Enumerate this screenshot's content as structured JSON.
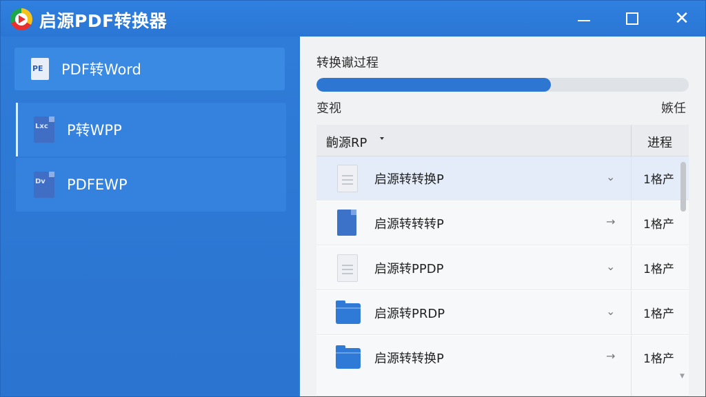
{
  "window": {
    "title": "启源PDF转换器",
    "close_glyph": "✕"
  },
  "sidebar": {
    "items": [
      {
        "label": "PDF转Word",
        "icon": "pe-doc-icon",
        "icon_text": "PE"
      },
      {
        "label": "P转WPP",
        "icon": "lxg-doc-icon",
        "icon_text": "Lxc"
      },
      {
        "label": "PDFEWP",
        "icon": "pdv-doc-icon",
        "icon_text": "Dv"
      }
    ]
  },
  "progress": {
    "title": "转换谳过程",
    "value_percent": 63,
    "left_label": "变视",
    "right_label": "嫉任"
  },
  "table": {
    "columns": {
      "name": "齣源RP",
      "progress": "进程"
    },
    "rows": [
      {
        "name": "启源转转换P",
        "icon": "file-gray-icon",
        "action": "⌄",
        "progress": "1格产",
        "selected": true
      },
      {
        "name": "启源转转转P",
        "icon": "file-blue-icon",
        "action": "→",
        "progress": "1格产",
        "selected": false
      },
      {
        "name": "启源转PPDP",
        "icon": "file-gray-icon",
        "action": "⌄",
        "progress": "1格产",
        "selected": false
      },
      {
        "name": "启源转PRDP",
        "icon": "folder-icon",
        "action": "⌄",
        "progress": "1格产",
        "selected": false
      },
      {
        "name": "启源转转换P",
        "icon": "folder-icon",
        "action": "→",
        "progress": "1格产",
        "selected": false
      }
    ]
  },
  "colors": {
    "accent": "#2d77d3",
    "titlebar": "#2f80e0",
    "panel": "#f1f2f4"
  }
}
